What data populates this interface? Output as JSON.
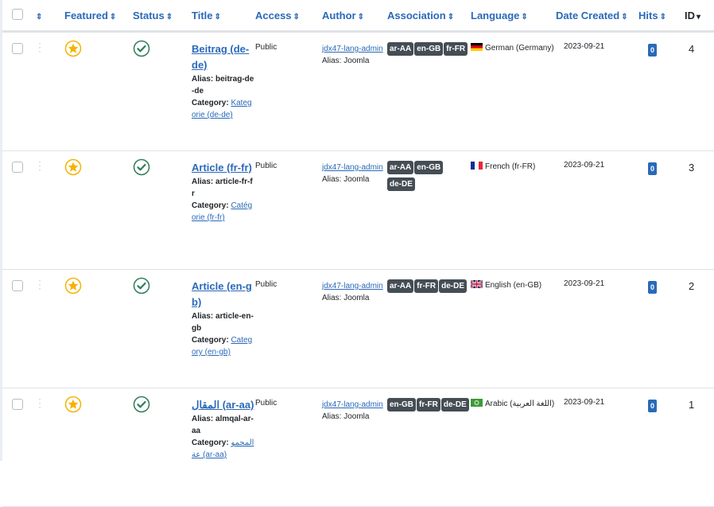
{
  "columns": {
    "ordering_icon": "sort-icon",
    "featured": "Featured",
    "status": "Status",
    "title": "Title",
    "access": "Access",
    "author": "Author",
    "association": "Association",
    "language": "Language",
    "date_created": "Date Created",
    "hits": "Hits",
    "id": "ID"
  },
  "sort_glyph": "⇕",
  "sort_active_glyph": "▾",
  "alias_label": "Alias: ",
  "category_label": "Category: ",
  "rows": [
    {
      "title": "Beitrag (de-de)",
      "alias": "beitrag-de-de",
      "category": "Kategorie (de-de)",
      "access": "Public",
      "author": "jdx47-lang-admin",
      "author_alias": "Alias: Joomla",
      "associations": [
        "ar-AA",
        "en-GB",
        "fr-FR"
      ],
      "language": "German (Germany)",
      "flag": "de",
      "date": "2023-09-21",
      "hits": "0",
      "id": "4"
    },
    {
      "title": "Article (fr-fr)",
      "alias": "article-fr-fr",
      "category": "Catégorie (fr-fr)",
      "access": "Public",
      "author": "jdx47-lang-admin",
      "author_alias": "Alias: Joomla",
      "associations": [
        "ar-AA",
        "en-GB",
        "de-DE"
      ],
      "language": "French (fr-FR)",
      "flag": "fr",
      "date": "2023-09-21",
      "hits": "0",
      "id": "3"
    },
    {
      "title": "Article (en-gb)",
      "alias": "article-en-gb",
      "category": "Category (en-gb)",
      "access": "Public",
      "author": "jdx47-lang-admin",
      "author_alias": "Alias: Joomla",
      "associations": [
        "ar-AA",
        "fr-FR",
        "de-DE"
      ],
      "language": "English (en-GB)",
      "flag": "gb",
      "date": "2023-09-21",
      "hits": "0",
      "id": "2"
    },
    {
      "title": "المقال (ar-aa)",
      "alias": "almqal-ar-aa",
      "category": "المجموعة (ar-aa)",
      "access": "Public",
      "author": "jdx47-lang-admin",
      "author_alias": "Alias: Joomla",
      "associations": [
        "en-GB",
        "fr-FR",
        "de-DE"
      ],
      "language": "Arabic (اللغة العربية)",
      "flag": "ar",
      "date": "2023-09-21",
      "hits": "0",
      "id": "1"
    }
  ],
  "colors": {
    "link": "#2a69b8",
    "badge": "#454d55",
    "featured": "#f5b301",
    "published": "#2f7d5a"
  }
}
